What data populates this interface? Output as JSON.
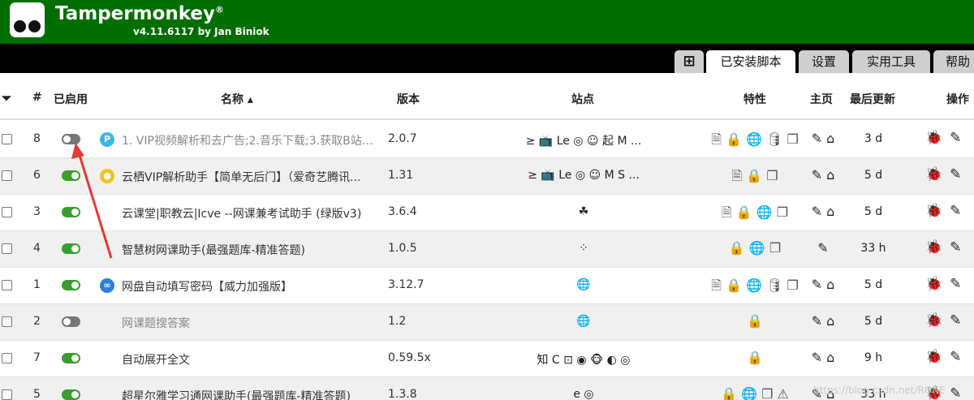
{
  "app": {
    "title": "Tampermonkey",
    "reg_mark": "®",
    "version": "v4.11.6117 by Jan Biniok"
  },
  "tabs": [
    {
      "label": "⊞"
    },
    {
      "label": "已安装脚本"
    },
    {
      "label": "设置"
    },
    {
      "label": "实用工具"
    },
    {
      "label": "帮助"
    }
  ],
  "table": {
    "headers": {
      "filter": "⏷",
      "num": "#",
      "enabled": "已启用",
      "name": "名称 ▴",
      "version": "版本",
      "sites": "站点",
      "features": "特性",
      "homepage": "主页",
      "updated": "最后更新",
      "actions": "操作"
    },
    "rows": [
      {
        "num": "8",
        "enabled": false,
        "icon_label": "P",
        "name": "1. VIP视频解析和去广告;2.音乐下载;3.获取B站封...",
        "version": "2.0.7",
        "sites": "≥ 📺 Le ◎ ☺ 起 M ...",
        "features": "🗎 🔒 🌐 🛢 ❐",
        "home": "✎ ⌂",
        "updated": "3 d"
      },
      {
        "num": "6",
        "enabled": true,
        "icon_label": "●",
        "name": "云栖VIP解析助手【简单无后门】（爱奇艺腾讯...",
        "version": "1.31",
        "sites": "≥ 📺 Le ◎ ☺ M S ...",
        "features": "🗎 🔒 ❐",
        "home": "✎ ⌂",
        "updated": "5 d"
      },
      {
        "num": "3",
        "enabled": true,
        "icon_label": "",
        "name": "云课堂|职教云|Icve --网课兼考试助手 (绿版v3)",
        "version": "3.6.4",
        "sites": "☘",
        "features": "🗎 🔒 🌐 ❐",
        "home": "✎ ⌂",
        "updated": "5 d"
      },
      {
        "num": "4",
        "enabled": true,
        "icon_label": "",
        "name": "智慧树网课助手(最强题库-精准答题)",
        "version": "1.0.5",
        "sites": "⁘",
        "features": "🔒 🌐 ❐",
        "home": "✎",
        "updated": "33 h"
      },
      {
        "num": "1",
        "enabled": true,
        "icon_label": "∞",
        "name": "网盘自动填写密码【威力加强版】",
        "version": "3.12.7",
        "sites": "🌐",
        "features": "🗎 🔒 🌐 🛢 ❐",
        "home": "✎ ⌂",
        "updated": "5 d"
      },
      {
        "num": "2",
        "enabled": false,
        "icon_label": "",
        "name": "网课题搜答案",
        "version": "1.2",
        "sites": "🌐",
        "features": "🔒",
        "home": "✎ ⌂",
        "updated": "5 d"
      },
      {
        "num": "7",
        "enabled": true,
        "icon_label": "",
        "name": "自动展开全文",
        "version": "0.59.5x",
        "sites": "知 C ⊡ ◉ 🐵 ◐ ◎",
        "features": "🔒",
        "home": "✎ ⌂",
        "updated": "9 h"
      },
      {
        "num": "5",
        "enabled": true,
        "icon_label": "",
        "name": "超星尔雅学习通网课助手(最强题库-精准答题)",
        "version": "1.3.8",
        "sites": "e ◎",
        "features": "🔒 🌐 ❐ ⚠",
        "home": "✎ ⌂",
        "updated": "33 h"
      }
    ]
  },
  "action_icons": {
    "edit": "✎",
    "bug": "🐞"
  },
  "watermark": "https://blog.csdn.net/RONE"
}
